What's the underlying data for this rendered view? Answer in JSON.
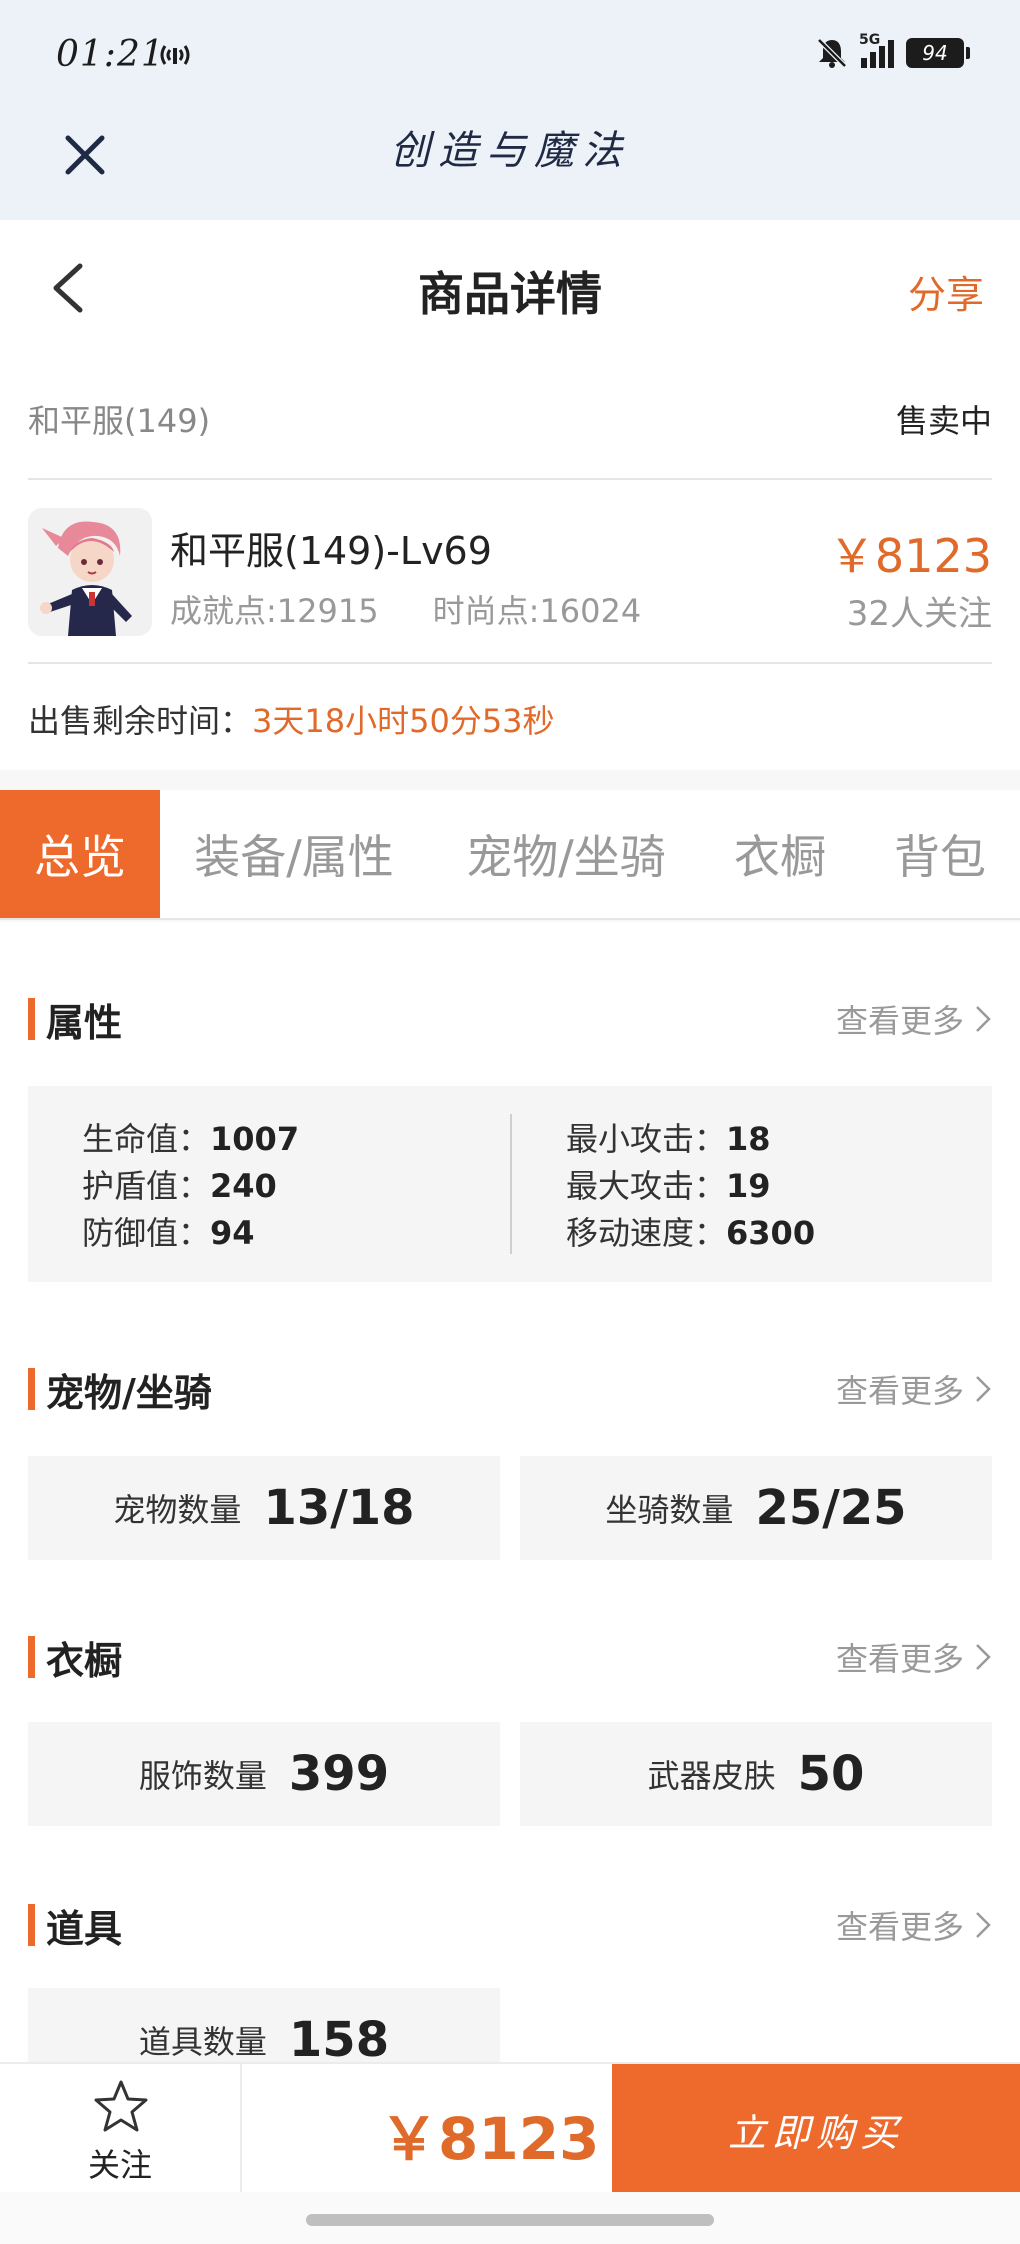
{
  "status_bar": {
    "time": "01:21",
    "network": "5G",
    "battery": "94"
  },
  "app": {
    "title": "创造与魔法"
  },
  "header": {
    "title": "商品详情",
    "share_label": "分享"
  },
  "product": {
    "name": "和平服(149)",
    "sale_status": "售卖中",
    "item_title": "和平服(149)-Lv69",
    "achievement": "成就点:12915",
    "fashion": "时尚点:16024",
    "price": "￥8123",
    "follows": "32人关注",
    "timer_label": "出售剩余时间：",
    "timer_value": "3天18小时50分53秒"
  },
  "tabs": [
    {
      "label": "总览",
      "active": true
    },
    {
      "label": "装备/属性",
      "active": false
    },
    {
      "label": "宠物/坐骑",
      "active": false
    },
    {
      "label": "衣橱",
      "active": false
    },
    {
      "label": "背包",
      "active": false
    }
  ],
  "sections": {
    "more_label": "查看更多",
    "attributes": {
      "title": "属性",
      "left": [
        {
          "label": "生命值：",
          "value": "1007"
        },
        {
          "label": "护盾值：",
          "value": "240"
        },
        {
          "label": "防御值：",
          "value": "94"
        }
      ],
      "right": [
        {
          "label": "最小攻击：",
          "value": "18"
        },
        {
          "label": "最大攻击：",
          "value": "19"
        },
        {
          "label": "移动速度：",
          "value": "6300"
        }
      ]
    },
    "pets": {
      "title": "宠物/坐骑",
      "stats": [
        {
          "label": "宠物数量",
          "value": "13/18"
        },
        {
          "label": "坐骑数量",
          "value": "25/25"
        }
      ]
    },
    "wardrobe": {
      "title": "衣橱",
      "stats": [
        {
          "label": "服饰数量",
          "value": "399"
        },
        {
          "label": "武器皮肤",
          "value": "50"
        }
      ]
    },
    "items": {
      "title": "道具",
      "stats": [
        {
          "label": "道具数量",
          "value": "158"
        }
      ]
    }
  },
  "bottom": {
    "follow_label": "关注",
    "price": "￥8123",
    "buy_label": "立即购买"
  },
  "colors": {
    "accent": "#ee6a2c",
    "price": "#e06a2a",
    "statusbar_bg": "#edf2f8"
  }
}
